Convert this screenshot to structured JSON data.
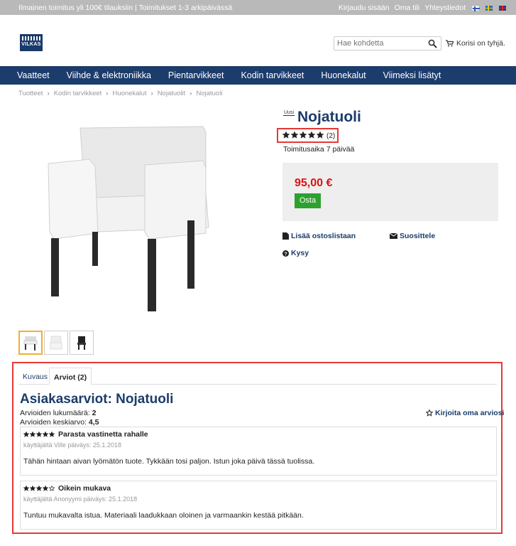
{
  "topbar": {
    "shipping": "Ilmainen toimitus yli 100€ tilauksiin | Toimitukset 1-3 arkipäivässä",
    "login": "Kirjaudu sisään",
    "account": "Oma tili",
    "contact": "Yhteystiedot"
  },
  "logo": {
    "text": "VILKAS"
  },
  "search": {
    "placeholder": "Hae kohdetta"
  },
  "cart": {
    "label": "Korisi on tyhjä."
  },
  "nav": [
    "Vaatteet",
    "Viihde & elektroniikka",
    "Pientarvikkeet",
    "Kodin tarvikkeet",
    "Huonekalut",
    "Viimeksi lisätyt"
  ],
  "breadcrumb": [
    "Tuotteet",
    "Kodin tarvikkeet",
    "Huonekalut",
    "Nojatuolit",
    "Nojatuoli"
  ],
  "product": {
    "badge": "Uusi",
    "title": "Nojatuoli",
    "rating_stars": 5,
    "rating_count": "(2)",
    "delivery": "Toimitusaika 7 päivää",
    "price": "95,00 €",
    "buy_label": "Osta",
    "add_list": "Lisää ostoslistaan",
    "recommend": "Suosittele",
    "ask": "Kysy"
  },
  "tabs": {
    "description": "Kuvaus",
    "reviews": "Arviot (2)"
  },
  "reviews": {
    "title": "Asiakasarviot: Nojatuoli",
    "count_label": "Arvioiden lukumäärä:",
    "count_value": "2",
    "avg_label": "Arvioiden keskiarvo:",
    "avg_value": "4,5",
    "write_label": "Kirjoita oma arviosi",
    "items": [
      {
        "stars": 5,
        "headline": "Parasta vastinetta rahalle",
        "byline": "käyttäjältä Ville päiväys: 25.1.2018",
        "text": "Tähän hintaan aivan lyömätön tuote. Tykkään tosi paljon. Istun joka päivä tässä tuolissa."
      },
      {
        "stars": 4,
        "headline": "Oikein mukava",
        "byline": "käyttäjältä Anonyymi päiväys: 25.1.2018",
        "text": "Tuntuu mukavalta istua. Materiaali laadukkaan oloinen ja varmaankin kestää pitkään."
      }
    ]
  },
  "colors": {
    "brand": "#1c3c6b",
    "price": "#e01010",
    "buy": "#2ea02e",
    "highlight": "#e53935"
  }
}
